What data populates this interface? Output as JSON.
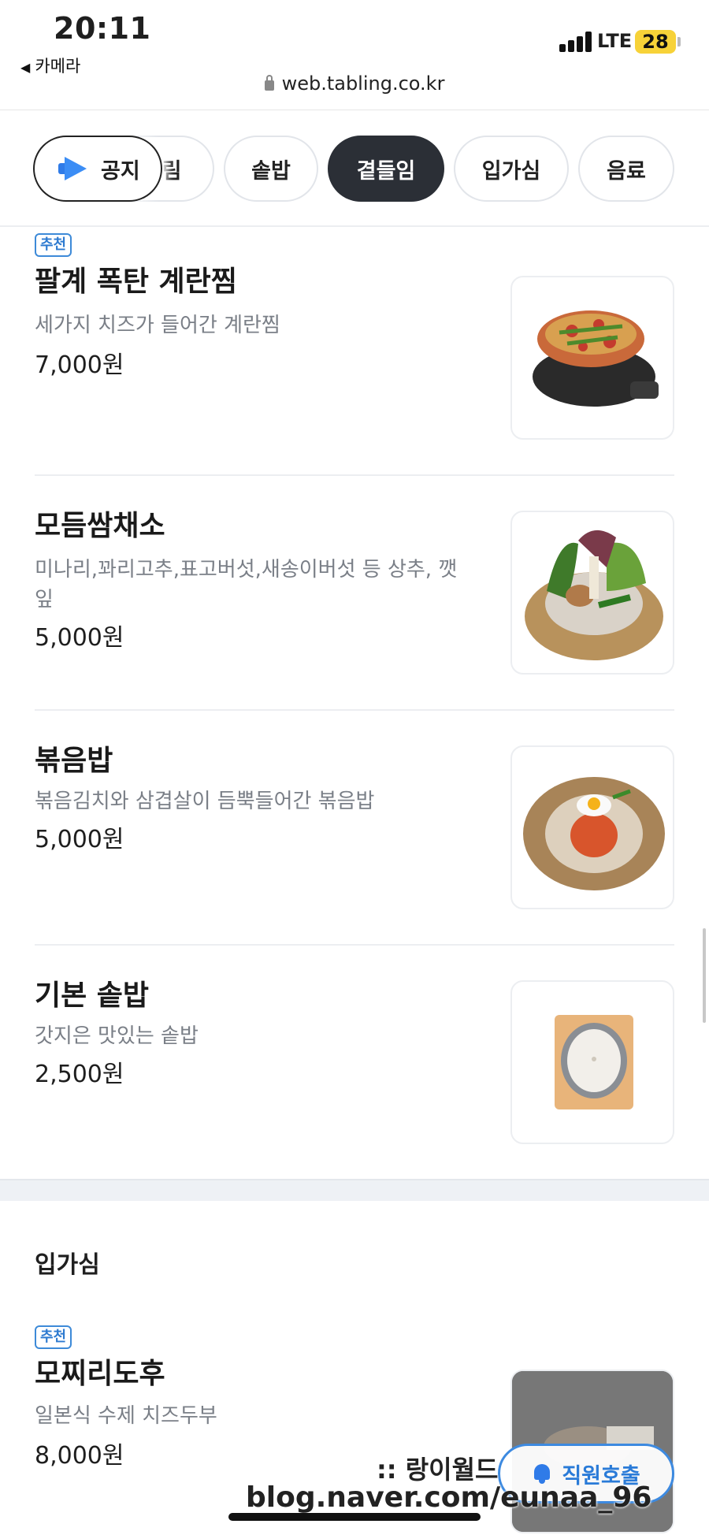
{
  "status_bar": {
    "time": "20:11",
    "back_app": "카메라",
    "network": "LTE",
    "battery": "28"
  },
  "browser": {
    "url": "web.tabling.co.kr"
  },
  "tabs": {
    "notice": "공지",
    "items": [
      "림",
      "솥밥",
      "곁들임",
      "입가심",
      "음료"
    ],
    "active": "곁들임"
  },
  "menu_items": [
    {
      "badge": "추천",
      "name": "팔계 폭탄 계란찜",
      "desc": "세가지 치즈가 들어간 계란찜",
      "price": "7,000원"
    },
    {
      "name": "모듬쌈채소",
      "desc": "미나리,꽈리고추,표고버섯,새송이버섯 등 상추, 깻잎",
      "price": "5,000원"
    },
    {
      "name": "볶음밥",
      "desc": "볶음김치와 삼겹살이 듬뿍들어간 볶음밥",
      "price": "5,000원"
    },
    {
      "name": "기본 솥밥",
      "desc": "갓지은 맛있는 솥밥",
      "price": "2,500원"
    }
  ],
  "section2": {
    "title": "입가심",
    "item": {
      "badge": "추천",
      "name": "모찌리도후",
      "desc": "일본식 수제 치즈두부",
      "price": "8,000원"
    }
  },
  "floating": {
    "staff_call": "직원호출"
  },
  "watermark": {
    "line1": ":: 랑이월드",
    "line2": "blog.naver.com/eunaa_96"
  },
  "colors": {
    "accent": "#2f7be8",
    "active_tab": "#2b2f36",
    "badge": "#3d8ad8"
  }
}
